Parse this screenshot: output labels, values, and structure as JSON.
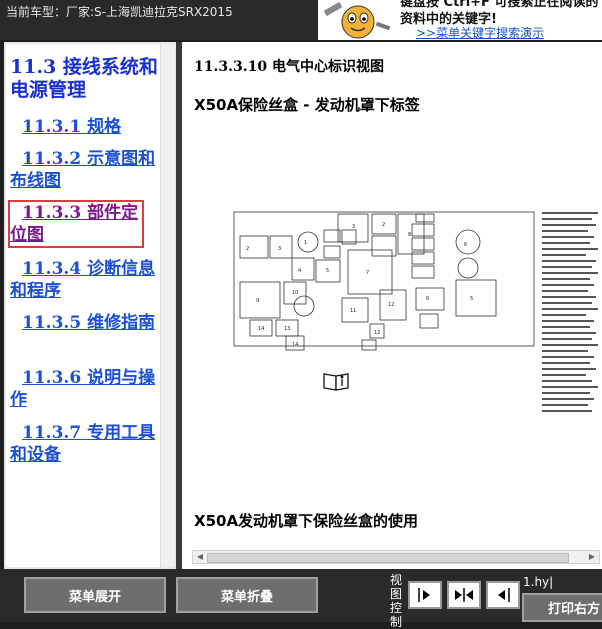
{
  "header": {
    "car_model": "当前车型：厂家:S-上海凯迪拉克SRX2015",
    "tip_text": "键盘按 Ctrl+F 可搜索正在阅读的资料中的关键字!",
    "tip_link": ">>菜单关键字搜索演示"
  },
  "nav": {
    "title": "11.3 接线系统和电源管理",
    "items": [
      {
        "num": "11.3.1",
        "label": "规格"
      },
      {
        "num": "11.3.2",
        "label": "示意图和布线图"
      },
      {
        "num": "11.3.3",
        "label": "部件定位图"
      },
      {
        "num": "11.3.4",
        "label": "诊断信息和程序"
      },
      {
        "num": "11.3.5",
        "label": "维修指南"
      },
      {
        "num": "11.3.6",
        "label": "说明与操作"
      },
      {
        "num": "11.3.7",
        "label": "专用工具和设备"
      }
    ]
  },
  "main": {
    "section_title": "11.3.3.10 电气中心标识视图",
    "fuse_heading": "X50A保险丝盒 - 发动机罩下标签",
    "usage_heading": "X50A发动机罩下保险丝盒的使用"
  },
  "toolbar": {
    "expand_label": "菜单展开",
    "collapse_label": "菜单折叠",
    "view_label": "视图控制",
    "file_name": "1.hy|",
    "print_label": "打印右方"
  }
}
